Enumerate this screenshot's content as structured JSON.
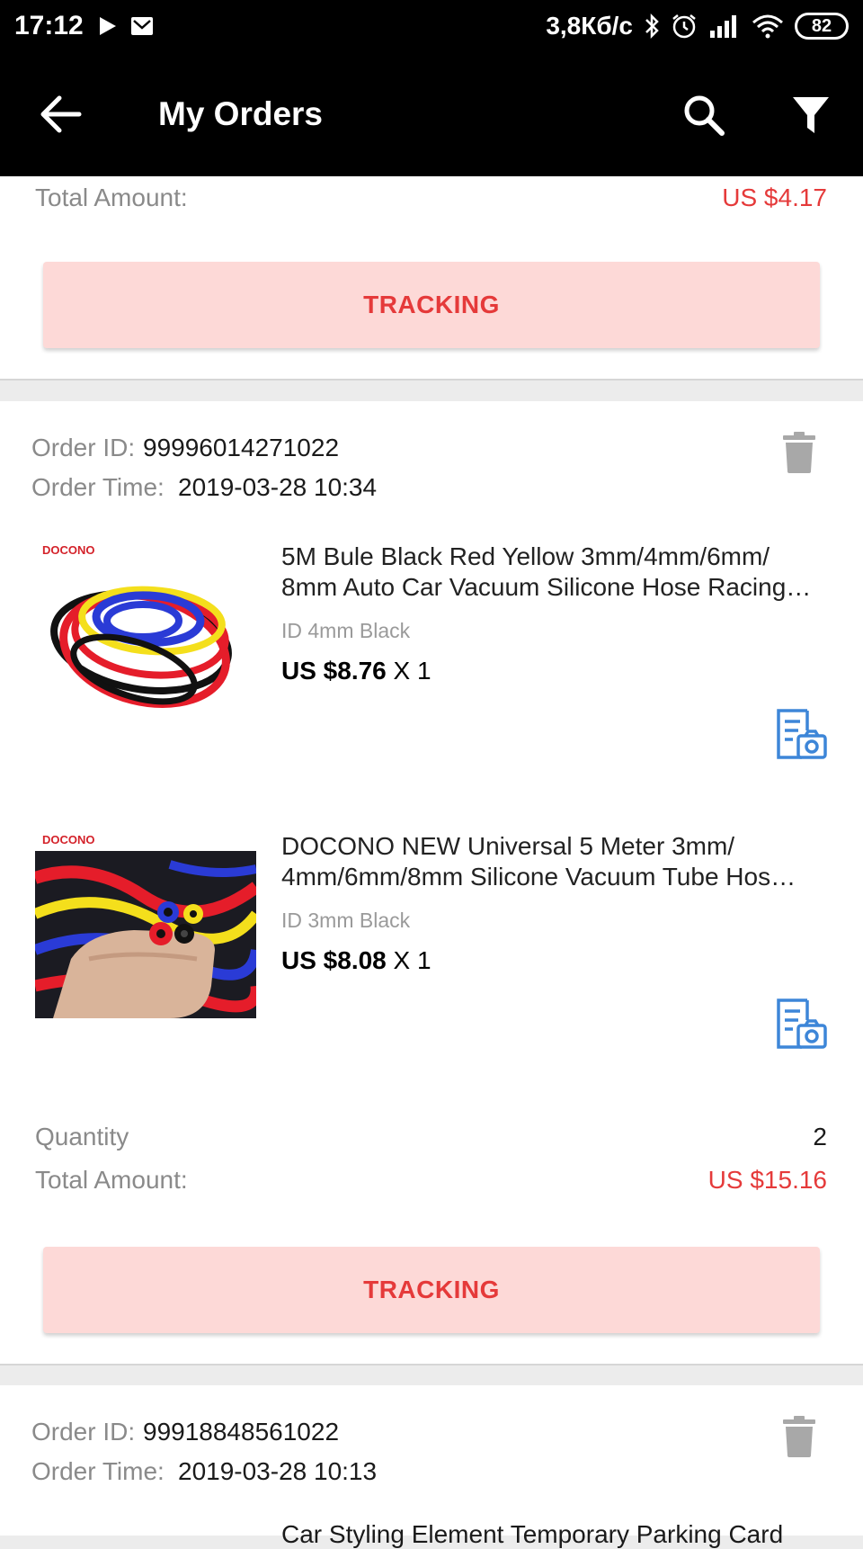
{
  "status_bar": {
    "time": "17:12",
    "speed": "3,8Кб/с",
    "battery": "82"
  },
  "app_bar": {
    "title": "My Orders"
  },
  "orders": [
    {
      "total_label": "Total Amount:",
      "total_value": "US $4.17",
      "tracking_label": "TRACKING"
    },
    {
      "order_id_label": "Order ID:",
      "order_id": "99996014271022",
      "order_time_label": "Order Time:",
      "order_time": "2019-03-28 10:34",
      "items": [
        {
          "brand": "DOCONO",
          "title_line1": "5M Bule Black Red Yellow 3mm/4mm/6mm/",
          "title_line2": "8mm Auto Car Vacuum Silicone Hose Racing…",
          "variant": "ID 4mm Black",
          "price": "US $8.76",
          "qty": "X 1"
        },
        {
          "brand": "DOCONO",
          "title_line1": "DOCONO NEW Universal 5 Meter 3mm/",
          "title_line2": "4mm/6mm/8mm Silicone Vacuum Tube Hos…",
          "variant": "ID 3mm Black",
          "price": "US $8.08",
          "qty": "X 1"
        }
      ],
      "quantity_label": "Quantity",
      "quantity_value": "2",
      "total_label": "Total Amount:",
      "total_value": "US $15.16",
      "tracking_label": "TRACKING"
    },
    {
      "order_id_label": "Order ID:",
      "order_id": "99918848561022",
      "order_time_label": "Order Time:",
      "order_time": "2019-03-28 10:13",
      "partial_title": "Car Styling Element Temporary Parking Card"
    }
  ],
  "colors": {
    "accent_red": "#e53a3a",
    "tracking_bg": "#fdd9d7",
    "icon_blue": "#3d86d8"
  }
}
